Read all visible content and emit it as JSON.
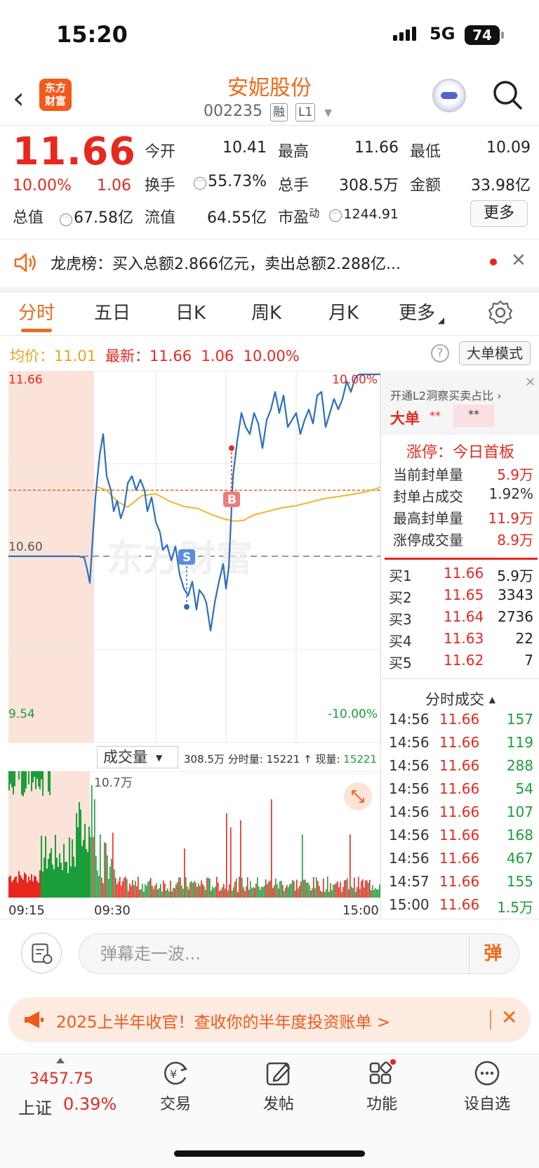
{
  "status": {
    "time": "15:20",
    "network": "5G",
    "battery": "74"
  },
  "header": {
    "logo_text_line1": "东方",
    "logo_text_line2": "财富",
    "stock_name": "安妮股份",
    "stock_code": "002235",
    "tag_margin": "融",
    "tag_level": "L1"
  },
  "quote": {
    "price": "11.66",
    "change_pct": "10.00%",
    "change": "1.06",
    "open_label": "今开",
    "open": "10.41",
    "high_label": "最高",
    "high": "11.66",
    "low_label": "最低",
    "low": "10.09",
    "turnover_label": "换手",
    "turnover": "55.73%",
    "volume_label": "总手",
    "volume": "308.5万",
    "amount_label": "金额",
    "amount": "33.98亿",
    "mcap_label": "总值",
    "mcap": "67.58亿",
    "float_label": "流值",
    "float": "64.55亿",
    "pe_label": "市盈",
    "pe_sup": "动",
    "pe": "1244.91",
    "more": "更多"
  },
  "dragon_tiger": {
    "text": "龙虎榜：买入总额2.866亿元，卖出总额2.288亿..."
  },
  "tabs": [
    "分时",
    "五日",
    "日K",
    "周K",
    "月K",
    "更多"
  ],
  "infoline": {
    "avg_label": "均价：",
    "avg": "11.01",
    "latest_label": "最新：",
    "latest": "11.66",
    "latest_chg": "1.06",
    "latest_pct": "10.00%",
    "help": "?",
    "big_order_mode": "大单模式"
  },
  "chart": {
    "y_top": "11.66",
    "y_mid": "10.60",
    "y_bottom": "9.54",
    "pct_top": "10.00%",
    "pct_bottom": "-10.00%",
    "buy_marker": "B",
    "sell_marker": "S",
    "watermark": "东方财富",
    "colors": {
      "price": "#2b6fbf",
      "avg": "#f3b52c",
      "up": "#e8281f",
      "down": "#1a9e3a"
    }
  },
  "volume": {
    "toggle": "成交量",
    "total": "308.5万",
    "minute_label": "分时量:",
    "minute": "15221",
    "now_label": "现量:",
    "now": "15221",
    "max": "10.7万",
    "time_start": "09:15",
    "time_open": "09:30",
    "time_end": "15:00"
  },
  "right_panel": {
    "l2_promo": "开通L2洞察买卖占比",
    "big_order": "大单",
    "stars1": "**",
    "stars2": "**",
    "limit_title": "涨停：今日首板",
    "limit_rows": [
      {
        "label": "当前封单量",
        "value": "5.9万",
        "red": true
      },
      {
        "label": "封单占成交",
        "value": "1.92%",
        "red": false
      },
      {
        "label": "最高封单量",
        "value": "11.9万",
        "red": true
      },
      {
        "label": "涨停成交量",
        "value": "8.9万",
        "red": true
      }
    ],
    "bids": [
      {
        "label": "买1",
        "price": "11.66",
        "qty": "5.9万"
      },
      {
        "label": "买2",
        "price": "11.65",
        "qty": "3343"
      },
      {
        "label": "买3",
        "price": "11.64",
        "qty": "2736"
      },
      {
        "label": "买4",
        "price": "11.63",
        "qty": "22"
      },
      {
        "label": "买5",
        "price": "11.62",
        "qty": "7"
      }
    ],
    "ticks_title": "分时成交",
    "ticks": [
      {
        "time": "14:56",
        "price": "11.66",
        "qty": "157",
        "color": "green"
      },
      {
        "time": "14:56",
        "price": "11.66",
        "qty": "119",
        "color": "green"
      },
      {
        "time": "14:56",
        "price": "11.66",
        "qty": "288",
        "color": "green"
      },
      {
        "time": "14:56",
        "price": "11.66",
        "qty": "54",
        "color": "green"
      },
      {
        "time": "14:56",
        "price": "11.66",
        "qty": "107",
        "color": "green"
      },
      {
        "time": "14:56",
        "price": "11.66",
        "qty": "168",
        "color": "green"
      },
      {
        "time": "14:56",
        "price": "11.66",
        "qty": "467",
        "color": "green"
      },
      {
        "time": "14:57",
        "price": "11.66",
        "qty": "155",
        "color": "green"
      },
      {
        "time": "15:00",
        "price": "11.66",
        "qty": "1.5万",
        "color": "green"
      }
    ]
  },
  "comment": {
    "placeholder": "弹幕走一波...",
    "dan": "弹"
  },
  "promo": {
    "text": "2025上半年收官！查收你的半年度投资账单 >"
  },
  "bottom_nav": {
    "index_value": "3457.75",
    "index_name": "上证",
    "index_pct": "0.39%",
    "items": [
      "交易",
      "发帖",
      "功能",
      "设自选"
    ]
  }
}
